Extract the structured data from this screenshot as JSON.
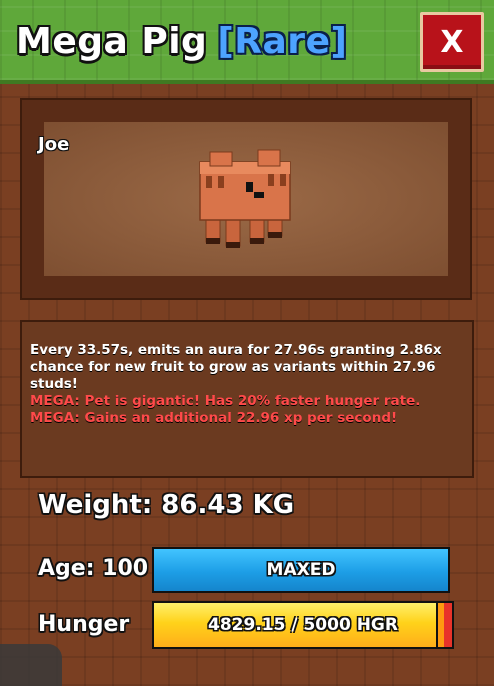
{
  "header": {
    "pet_name": "Mega Pig",
    "rarity": "[Rare]",
    "close_label": "X"
  },
  "pet_view": {
    "owner_name": "Joe"
  },
  "description": {
    "ability": "Every 33.57s, emits an aura for 27.96s granting 2.86x chance for new fruit to grow as variants within 27.96 studs!",
    "mega_lines": [
      "MEGA: Pet is gigantic! Has 20% faster hunger rate.",
      "MEGA: Gains an additional 22.96 xp per second!"
    ]
  },
  "stats": {
    "weight": "Weight: 86.43 KG",
    "age_label": "Age: 100",
    "age_bar_text": "MAXED",
    "hunger_label": "Hunger",
    "hunger_text": "4829.15 / 5000 HGR",
    "hunger_fraction": 0.9658
  },
  "colors": {
    "header_green": "#5fa83a",
    "rarity_blue": "#4da3ff",
    "close_red": "#b8121a",
    "mega_red": "#ff4a4a",
    "age_bar_blue": "#1d9ee6",
    "hunger_yellow": "#ffd21a"
  },
  "icons": {
    "close": "close-icon",
    "pet": "pig-model-icon"
  }
}
